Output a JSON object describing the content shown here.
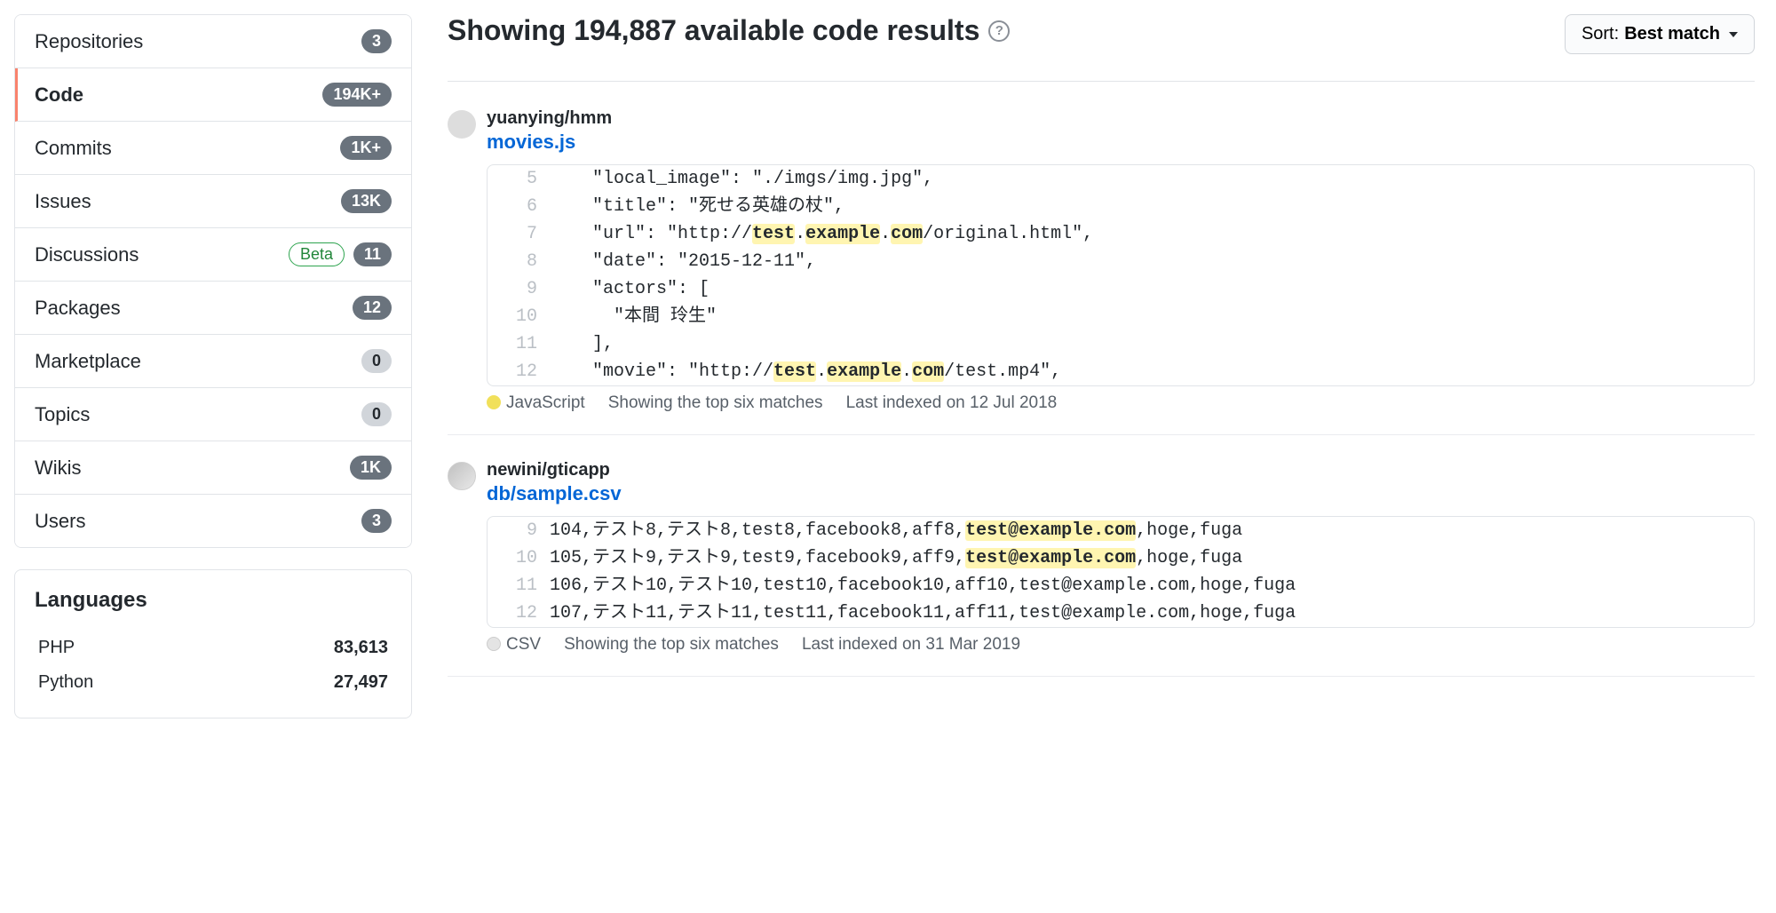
{
  "sidebar": {
    "menu": [
      {
        "label": "Repositories",
        "count": "3",
        "active": false,
        "beta": false
      },
      {
        "label": "Code",
        "count": "194K+",
        "active": true,
        "beta": false
      },
      {
        "label": "Commits",
        "count": "1K+",
        "active": false,
        "beta": false
      },
      {
        "label": "Issues",
        "count": "13K",
        "active": false,
        "beta": false
      },
      {
        "label": "Discussions",
        "count": "11",
        "active": false,
        "beta": true
      },
      {
        "label": "Packages",
        "count": "12",
        "active": false,
        "beta": false
      },
      {
        "label": "Marketplace",
        "count": "0",
        "active": false,
        "beta": false,
        "light": true
      },
      {
        "label": "Topics",
        "count": "0",
        "active": false,
        "beta": false,
        "light": true
      },
      {
        "label": "Wikis",
        "count": "1K",
        "active": false,
        "beta": false
      },
      {
        "label": "Users",
        "count": "3",
        "active": false,
        "beta": false
      }
    ],
    "beta_label": "Beta",
    "languages_title": "Languages",
    "languages": [
      {
        "name": "PHP",
        "count": "83,613"
      },
      {
        "name": "Python",
        "count": "27,497"
      }
    ]
  },
  "main": {
    "heading": "Showing 194,887 available code results",
    "sort_prefix": "Sort:",
    "sort_value": "Best match",
    "results": [
      {
        "repo": "yuanying/hmm",
        "file": "movies.js",
        "lines": [
          {
            "n": "5",
            "pre": "    \"local_image\": \"./imgs/img.jpg\",",
            "hl": "",
            "post": ""
          },
          {
            "n": "6",
            "pre": "    \"title\": \"死せる英雄の杖\",",
            "hl": "",
            "post": ""
          },
          {
            "n": "7",
            "pre": "    \"url\": \"http://",
            "hl": "test.example.com",
            "post": "/original.html\","
          },
          {
            "n": "8",
            "pre": "    \"date\": \"2015-12-11\",",
            "hl": "",
            "post": ""
          },
          {
            "n": "9",
            "pre": "    \"actors\": [",
            "hl": "",
            "post": ""
          },
          {
            "n": "10",
            "pre": "      \"本間 玲生\"",
            "hl": "",
            "post": ""
          },
          {
            "n": "11",
            "pre": "    ],",
            "hl": "",
            "post": ""
          },
          {
            "n": "12",
            "pre": "    \"movie\": \"http://",
            "hl": "test.example.com",
            "post": "/test.mp4\","
          }
        ],
        "language": "JavaScript",
        "matches": "Showing the top six matches",
        "indexed": "Last indexed on 12 Jul 2018"
      },
      {
        "repo": "newini/gticapp",
        "file": "db/sample.csv",
        "lines": [
          {
            "n": "9",
            "pre": "104,テスト8,テスト8,test8,facebook8,aff8,",
            "hl": "test@example.com",
            "post": ",hoge,fuga"
          },
          {
            "n": "10",
            "pre": "105,テスト9,テスト9,test9,facebook9,aff9,",
            "hl": "test@example.com",
            "post": ",hoge,fuga"
          },
          {
            "n": "11",
            "pre": "106,テスト10,テスト10,test10,facebook10,aff10,test@example.com,hoge,fuga",
            "hl": "",
            "post": ""
          },
          {
            "n": "12",
            "pre": "107,テスト11,テスト11,test11,facebook11,aff11,test@example.com,hoge,fuga",
            "hl": "",
            "post": ""
          }
        ],
        "language": "CSV",
        "matches": "Showing the top six matches",
        "indexed": "Last indexed on 31 Mar 2019"
      }
    ]
  }
}
